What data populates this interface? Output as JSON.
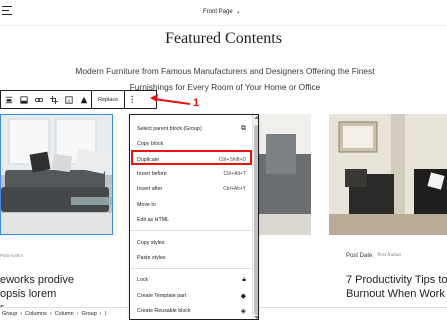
{
  "topbar": {
    "page_selector": "Front Page"
  },
  "content": {
    "heading": "Featured Contents",
    "subtext": "Modern Furniture from Famous Manufacturers and Designers Offering the Finest Furnishings for Every Room of Your Home or Office"
  },
  "toolbar": {
    "replace_label": "Replace",
    "more_label": "⋮"
  },
  "annotation": {
    "number": "1",
    "color": "#e11111"
  },
  "cards": {
    "left": {
      "author": "Post Author",
      "title": "eworks prodive\nopsis lorem\nr"
    },
    "right": {
      "date_label": "Post Date",
      "author": "Post Author",
      "title": "7 Productivity Tips to\nBurnout When Work"
    }
  },
  "menu": {
    "items": [
      {
        "label": "Select parent block (Group)",
        "shortcut": "",
        "icon": "parent-block-icon"
      },
      {
        "label": "Copy block",
        "shortcut": "",
        "icon": ""
      },
      {
        "label": "Duplicate",
        "shortcut": "Ctrl+Shift+D",
        "icon": ""
      },
      {
        "label": "Insert before",
        "shortcut": "Ctrl+Alt+T",
        "icon": ""
      },
      {
        "label": "Insert after",
        "shortcut": "Ctrl+Alt+Y",
        "icon": ""
      },
      {
        "label": "Move to",
        "shortcut": "",
        "icon": ""
      },
      {
        "label": "Edit as HTML",
        "shortcut": "",
        "icon": ""
      },
      {
        "label": "Copy styles",
        "shortcut": "",
        "icon": ""
      },
      {
        "label": "Paste styles",
        "shortcut": "",
        "icon": ""
      },
      {
        "label": "Lock",
        "shortcut": "",
        "icon": "lock-icon"
      },
      {
        "label": "Create Template part",
        "shortcut": "",
        "icon": "template-part-icon"
      },
      {
        "label": "Create Reusable block",
        "shortcut": "",
        "icon": "reusable-block-icon"
      }
    ]
  },
  "breadcrumb": [
    "Group",
    "Columns",
    "Column",
    "Group",
    "⟩"
  ]
}
